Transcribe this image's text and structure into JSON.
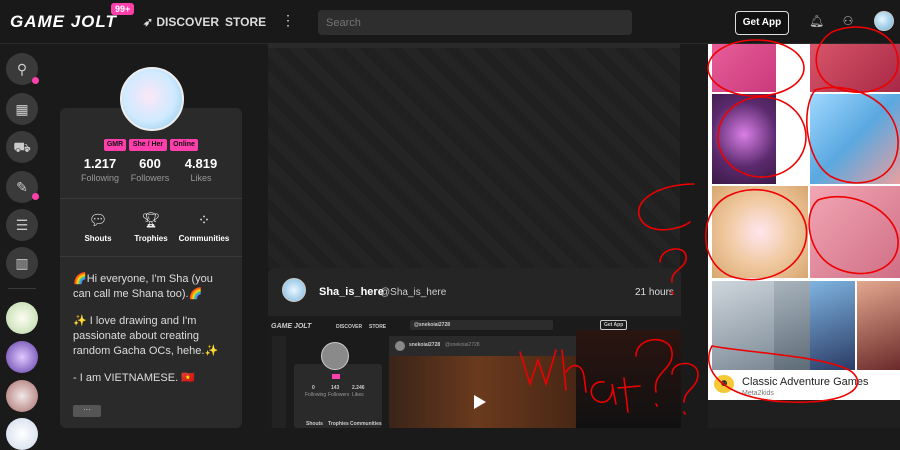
{
  "header": {
    "logo_text": "GAME JOLT",
    "notification_count": "99+",
    "nav_discover": "DISCOVER",
    "nav_store": "STORE",
    "search_placeholder": "Search",
    "get_app_label": "Get App"
  },
  "profile": {
    "tags": [
      "GMR",
      "She / Her",
      "Online"
    ],
    "stats": [
      {
        "value": "1.217",
        "label": "Following"
      },
      {
        "value": "600",
        "label": "Followers"
      },
      {
        "value": "4.819",
        "label": "Likes"
      }
    ],
    "links": [
      "Shouts",
      "Trophies",
      "Communities"
    ],
    "bio_lines": [
      "🌈Hi everyone, I'm Sha (you can call me Shana too).🌈",
      "✨ I love drawing and I'm passionate about creating random Gacha OCs, hehe.✨",
      "- I am VIETNAMESE. 🇻🇳"
    ],
    "more_label": "···"
  },
  "post": {
    "username": "Sha_is_here",
    "handle": "@Sha_is_here",
    "time": "21 hours",
    "embed": {
      "nav_discover": "DISCOVER",
      "nav_store": "STORE",
      "get_app": "Get App",
      "search_text": "@snekoiai2728",
      "stats": [
        "0",
        "143",
        "2.246"
      ],
      "stat_labels": [
        "Following",
        "Followers",
        "Likes"
      ],
      "links": [
        "Shouts",
        "Trophies",
        "Communities"
      ],
      "video_user": "snekoiai2728",
      "video_handle": "@snekoiai2728"
    }
  },
  "game": {
    "title": "Classic Adventure Games",
    "developer": "Meta2kids"
  },
  "annotations": {
    "question": "?",
    "scrawl_1": "Wh",
    "scrawl_2": "at?",
    "scrawl_3": "?"
  }
}
